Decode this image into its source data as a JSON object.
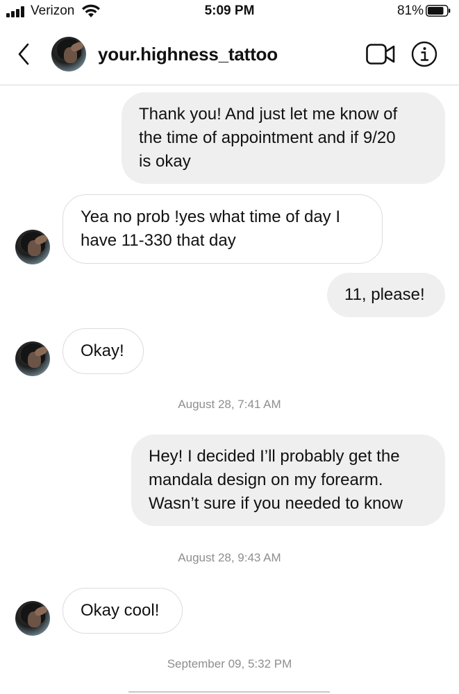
{
  "status_bar": {
    "carrier": "Verizon",
    "time": "5:09 PM",
    "battery_percent": "81%",
    "icons": [
      "signal-icon",
      "wifi-icon",
      "battery-icon"
    ]
  },
  "header": {
    "username": "your.highness_tattoo",
    "icons": [
      "back-chevron-icon",
      "avatar",
      "video-call-icon",
      "info-icon"
    ]
  },
  "messages": [
    {
      "direction": "outgoing",
      "lines": [
        "Thank you! And just let me know of",
        "the time of appointment and if 9/20",
        "is okay"
      ]
    },
    {
      "direction": "incoming",
      "lines": [
        "Yea no prob !yes what time of day I",
        "have 11-330 that day"
      ]
    },
    {
      "direction": "outgoing",
      "lines": [
        "11, please!"
      ]
    },
    {
      "direction": "incoming",
      "lines": [
        "Okay!"
      ]
    },
    {
      "type": "timestamp",
      "text": "August 28, 7:41 AM"
    },
    {
      "direction": "outgoing",
      "lines": [
        "Hey! I decided I’ll probably get the",
        "mandala design on my forearm.",
        "Wasn’t sure if you needed to know"
      ]
    },
    {
      "type": "timestamp",
      "text": "August 28, 9:43 AM"
    },
    {
      "direction": "incoming",
      "lines": [
        "Okay cool!"
      ]
    },
    {
      "type": "timestamp",
      "text": "September 09, 5:32 PM"
    }
  ]
}
